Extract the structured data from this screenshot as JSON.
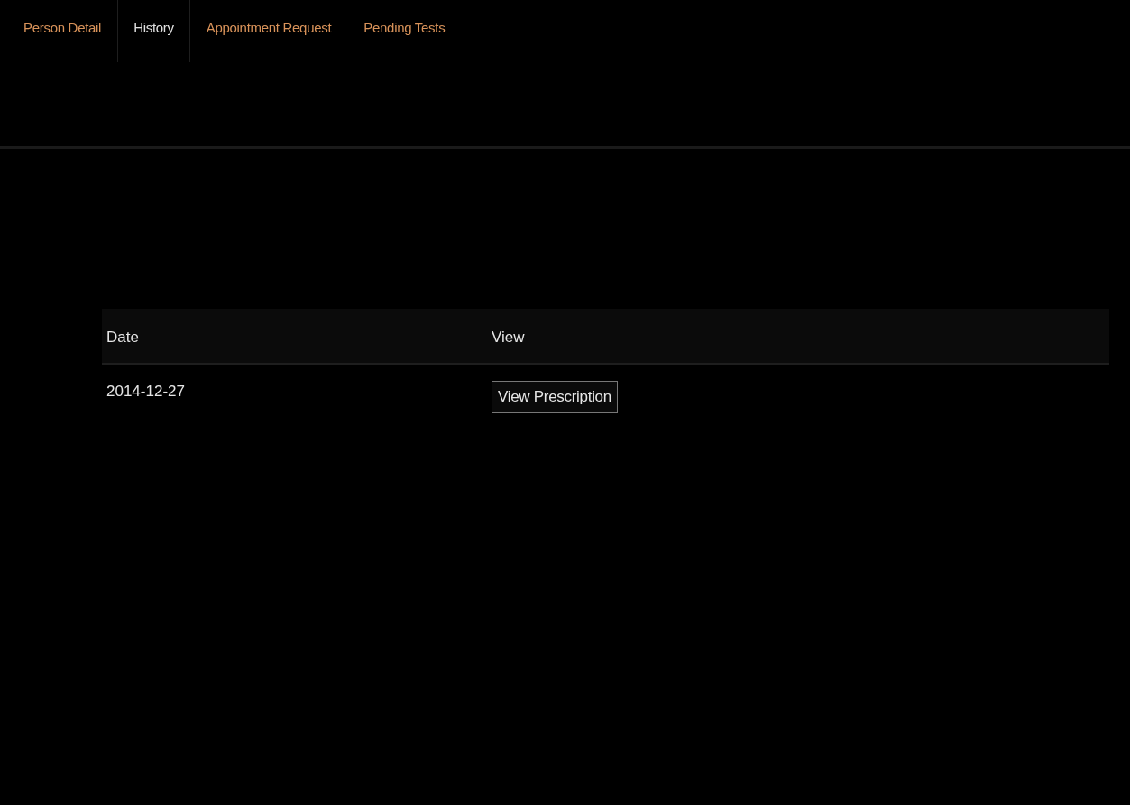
{
  "tabs": [
    {
      "label": "Person Detail",
      "selected": false
    },
    {
      "label": "History",
      "selected": true
    },
    {
      "label": "Appointment Request",
      "selected": false
    },
    {
      "label": "Pending Tests",
      "selected": false
    }
  ],
  "table": {
    "columns": [
      "Date",
      "View"
    ],
    "rows": [
      {
        "date": "2014-12-27",
        "action": "View Prescription"
      }
    ]
  }
}
